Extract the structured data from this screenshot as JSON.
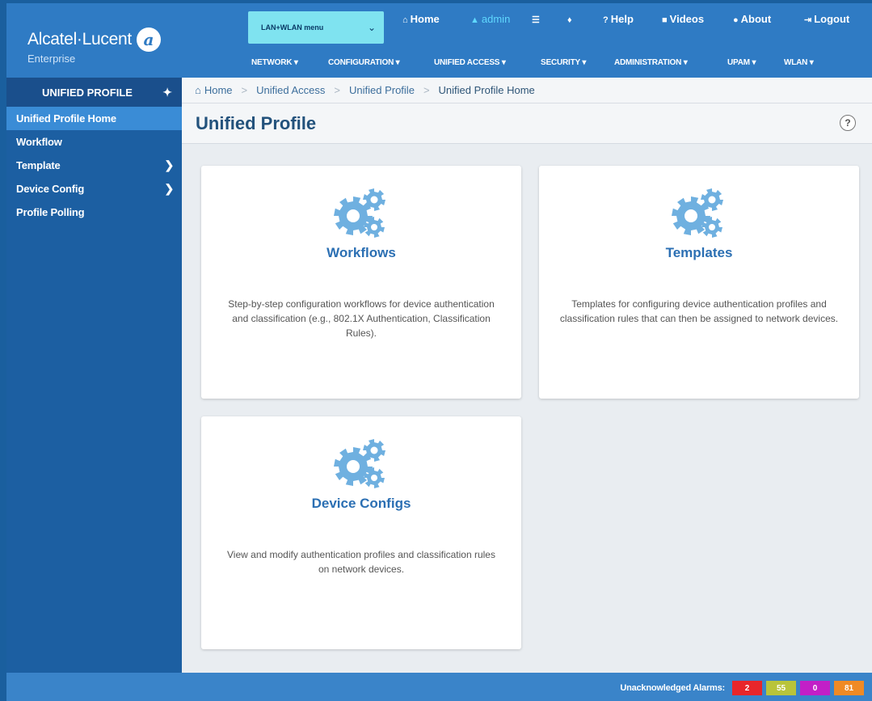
{
  "brand": {
    "name": "Alcatel·Lucent",
    "sub": "Enterprise"
  },
  "lan_select": {
    "value": "LAN+WLAN menu"
  },
  "topnav": [
    {
      "icon": "home-icon",
      "glyph": "⌂",
      "label": "Home"
    },
    {
      "icon": "user-icon",
      "glyph": "▲",
      "label": "admin"
    },
    {
      "icon": "list-icon",
      "glyph": "☰",
      "label": ""
    },
    {
      "icon": "bell-icon",
      "glyph": "♪",
      "label": ""
    },
    {
      "icon": "question-icon",
      "glyph": "?",
      "label": "Help"
    },
    {
      "icon": "video-icon",
      "glyph": "■",
      "label": "Videos"
    },
    {
      "icon": "info-icon",
      "glyph": "ℹ",
      "label": "About"
    },
    {
      "icon": "logout-icon",
      "glyph": "⇥",
      "label": "Logout"
    }
  ],
  "mainnav": [
    "NETWORK ▾",
    "CONFIGURATION ▾",
    "UNIFIED ACCESS ▾",
    "SECURITY ▾",
    "ADMINISTRATION ▾",
    "UPAM ▾",
    "WLAN ▾"
  ],
  "sidebar": {
    "title": "UNIFIED PROFILE",
    "items": [
      {
        "label": "Unified Profile Home",
        "active": true,
        "submenu": false
      },
      {
        "label": "Workflow",
        "active": false,
        "submenu": false
      },
      {
        "label": "Template",
        "active": false,
        "submenu": true
      },
      {
        "label": "Device Config",
        "active": false,
        "submenu": true
      },
      {
        "label": "Profile Polling",
        "active": false,
        "submenu": false
      }
    ]
  },
  "breadcrumb": [
    "Home",
    "Unified Access",
    "Unified Profile",
    "Unified Profile Home"
  ],
  "page": {
    "title": "Unified Profile",
    "help": "?"
  },
  "cards": [
    {
      "title": "Workflows",
      "desc": "Step-by-step configuration workflows for device authentication and classification (e.g., 802.1X Authentication, Classification Rules)."
    },
    {
      "title": "Templates",
      "desc": "Templates for configuring device authentication profiles and classification rules that can then be assigned to network devices."
    },
    {
      "title": "Device Configs",
      "desc": "View and modify authentication profiles and classification rules on network devices."
    }
  ],
  "footer": {
    "alarms_label": "Unacknowledged Alarms:",
    "alarms": [
      {
        "value": "2",
        "color": "#e8262a"
      },
      {
        "value": "55",
        "color": "#b9c43a"
      },
      {
        "value": "0",
        "color": "#c21fc7"
      },
      {
        "value": "81",
        "color": "#f08a24"
      }
    ]
  },
  "colors": {
    "header": "#2f7bc4",
    "sidebar": "#1c5fa2",
    "active_item": "#3a8cd6",
    "accent": "#2b6fb3",
    "gear": "#6fb0e0"
  }
}
